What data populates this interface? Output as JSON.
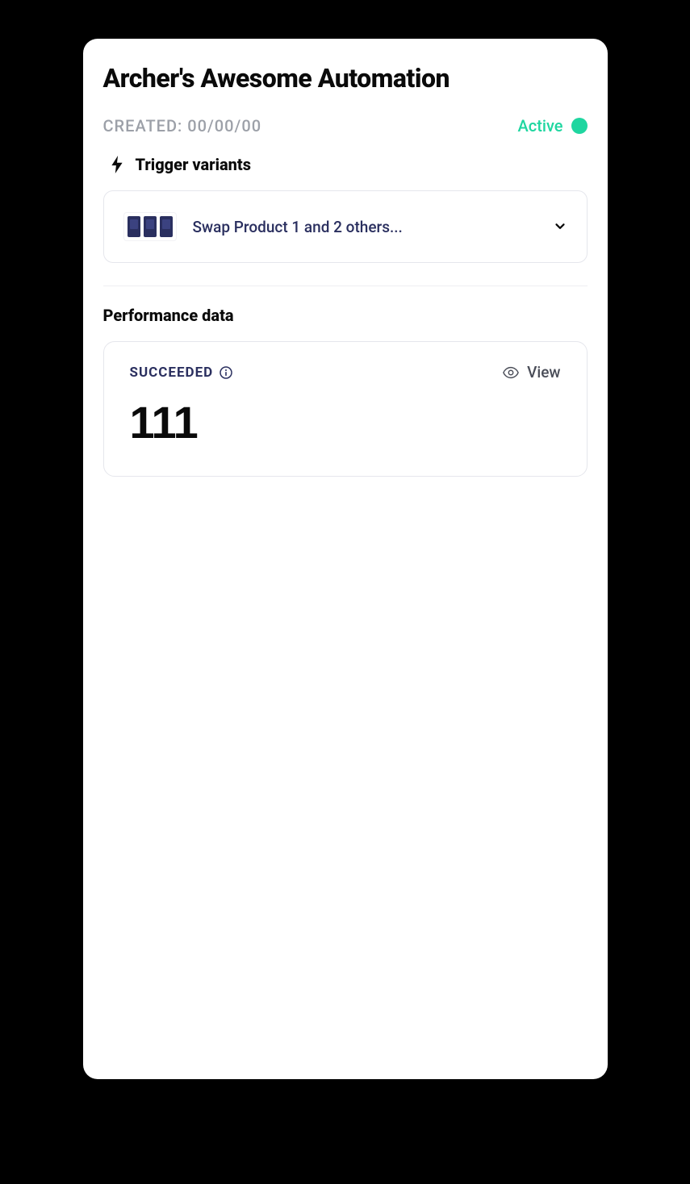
{
  "title": "Archer's Awesome Automation",
  "created_label": "CREATED: 00/00/00",
  "status": {
    "text": "Active"
  },
  "trigger_section": {
    "title": "Trigger variants",
    "variant_label": "Swap Product 1 and 2 others..."
  },
  "performance_section": {
    "title": "Performance data",
    "succeeded_label": "SUCCEEDED",
    "view_label": "View",
    "metric": "111"
  }
}
